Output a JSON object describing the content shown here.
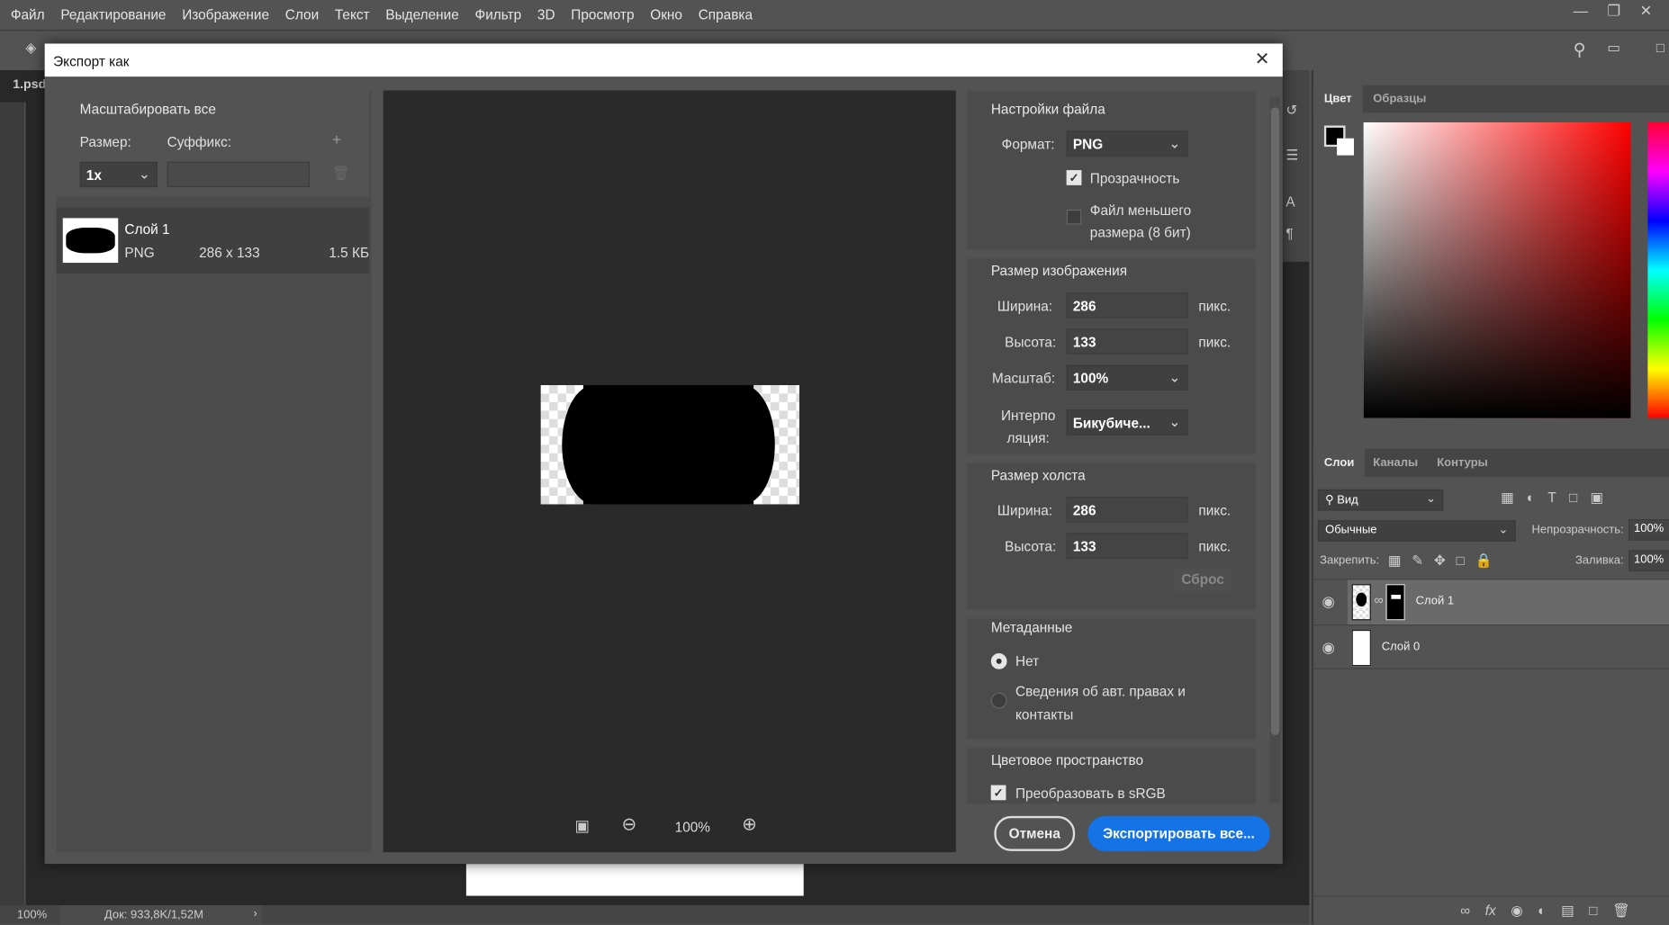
{
  "menu": [
    "Файл",
    "Редактирование",
    "Изображение",
    "Слои",
    "Текст",
    "Выделение",
    "Фильтр",
    "3D",
    "Просмотр",
    "Окно",
    "Справка"
  ],
  "doc_tab": "1.psd",
  "status": {
    "zoom": "100%",
    "doc": "Док: 933,8K/1,52M"
  },
  "dialog": {
    "title": "Экспорт как",
    "left": {
      "scale_all": "Масштабировать все",
      "size_label": "Размер:",
      "suffix_label": "Суффикс:",
      "size_value": "1x",
      "suffix_value": "",
      "item": {
        "name": "Слой 1",
        "format": "PNG",
        "dims": "286 x 133",
        "filesize": "1.5 КБ"
      }
    },
    "preview": {
      "zoom": "100%"
    },
    "file_settings": {
      "header": "Настройки файла",
      "format_label": "Формат:",
      "format_value": "PNG",
      "transparency": "Прозрачность",
      "transparency_checked": true,
      "smaller_file": "Файл меньшего размера (8 бит)",
      "smaller_file_checked": false
    },
    "image_size": {
      "header": "Размер изображения",
      "width_label": "Ширина:",
      "width": "286",
      "height_label": "Высота:",
      "height": "133",
      "unit": "пикс.",
      "scale_label": "Масштаб:",
      "scale": "100%",
      "interp_label": "Интерполяция:",
      "interp_label_l1": "Интерпо",
      "interp_label_l2": "ляция:",
      "interp": "Бикубиче..."
    },
    "canvas_size": {
      "header": "Размер холста",
      "width_label": "Ширина:",
      "width": "286",
      "height_label": "Высота:",
      "height": "133",
      "unit": "пикс.",
      "reset": "Сброс"
    },
    "metadata": {
      "header": "Метаданные",
      "none": "Нет",
      "copyright": "Сведения об авт. правах и контакты",
      "copyright_l1": "Сведения об авт. правах и",
      "copyright_l2": "контакты",
      "selected": "none"
    },
    "colorspace": {
      "header": "Цветовое пространство",
      "srgb": "Преобразовать в sRGB",
      "srgb_checked": true
    },
    "cancel": "Отмена",
    "export": "Экспортировать все...",
    "accent": "#1473e6"
  },
  "panels": {
    "color_tabs": [
      "Цвет",
      "Образцы"
    ],
    "layer_tabs": [
      "Слои",
      "Каналы",
      "Контуры"
    ],
    "filter": "Вид",
    "blend": "Обычные",
    "opacity_label": "Непрозрачность:",
    "opacity": "100%",
    "lock_label": "Закрепить:",
    "fill_label": "Заливка:",
    "fill": "100%",
    "layers": [
      {
        "name": "Слой 1",
        "visible": true,
        "selected": true
      },
      {
        "name": "Слой 0",
        "visible": true,
        "selected": false
      }
    ]
  }
}
